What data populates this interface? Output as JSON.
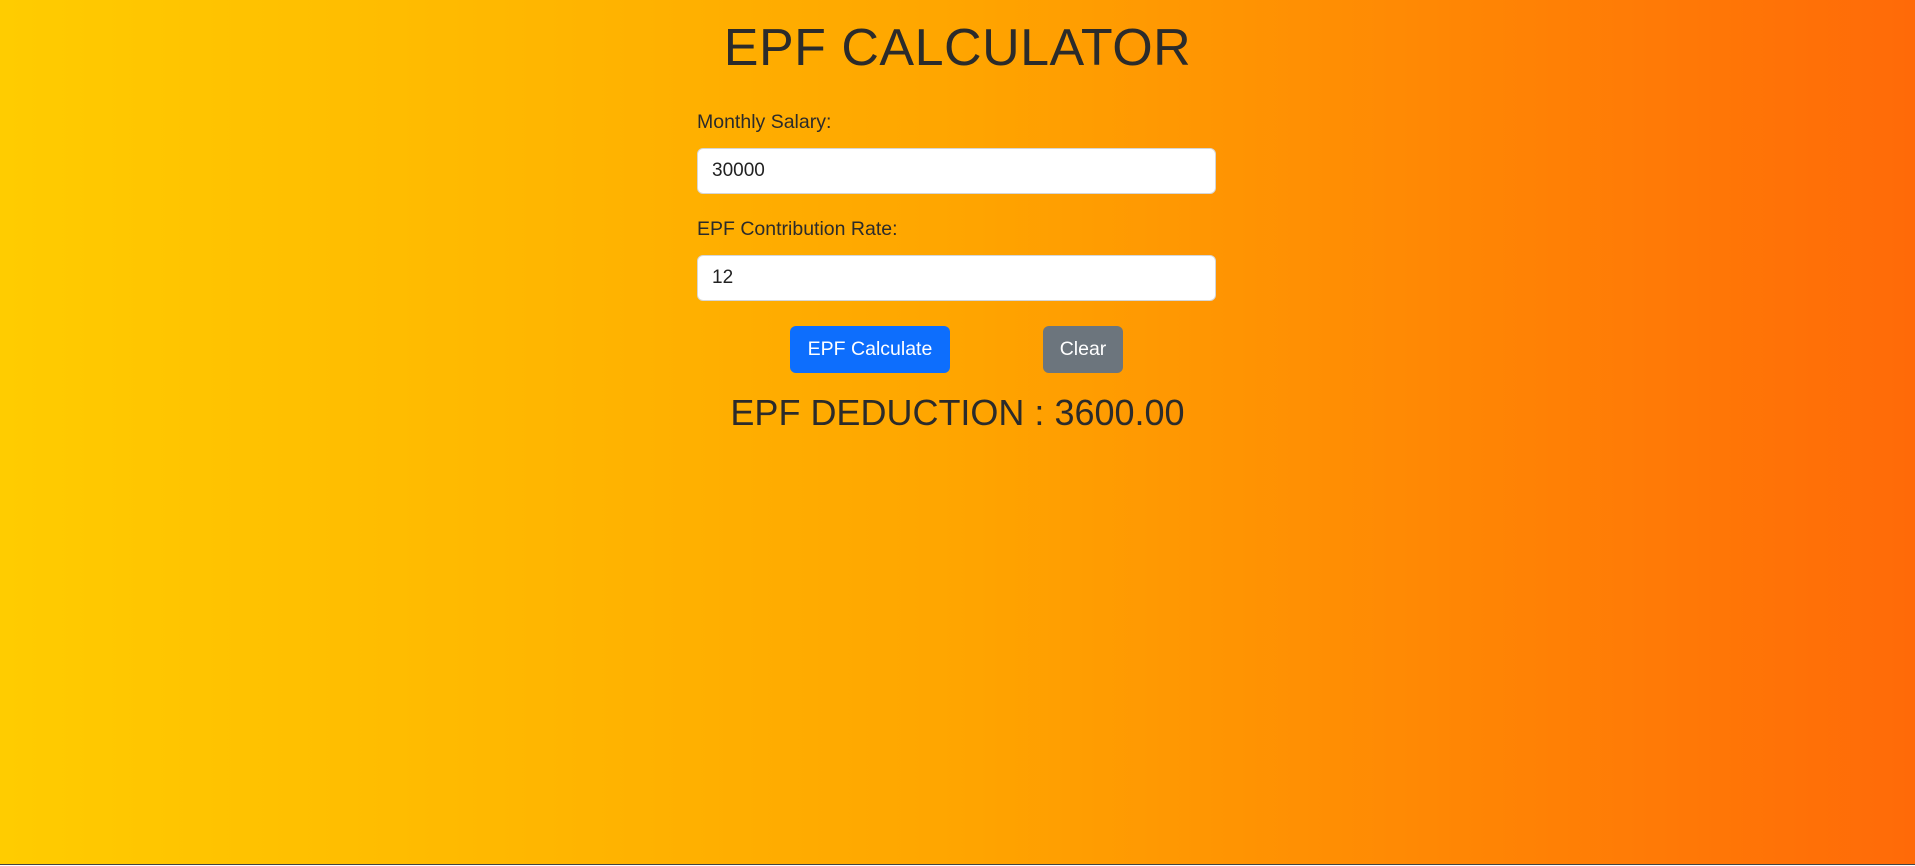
{
  "page": {
    "title": "EPF CALCULATOR"
  },
  "form": {
    "salary_label": "Monthly Salary:",
    "salary_value": "30000",
    "rate_label": "EPF Contribution Rate:",
    "rate_value": "12"
  },
  "buttons": {
    "calculate_label": "EPF Calculate",
    "clear_label": "Clear"
  },
  "result": {
    "text": "EPF DEDUCTION : 3600.00"
  },
  "colors": {
    "gradient_start": "#ffcc00",
    "gradient_end": "#ff6a08",
    "primary_button": "#0d6efd",
    "secondary_button": "#6c757d"
  }
}
